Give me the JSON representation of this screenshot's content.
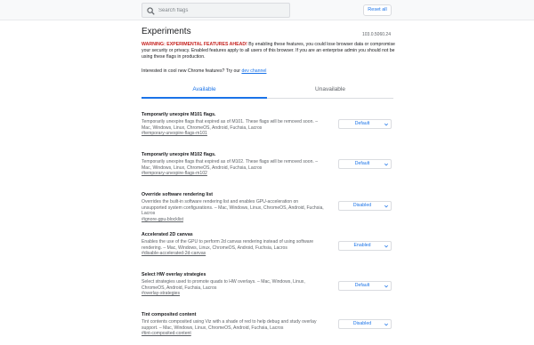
{
  "header": {
    "search_placeholder": "Search flags",
    "reset_label": "Reset all"
  },
  "page": {
    "title": "Experiments",
    "version": "103.0.5060.24",
    "warning_strong": "WARNING: EXPERIMENTAL FEATURES AHEAD!",
    "warning_text": " By enabling these features, you could lose browser data or compromise your security or privacy. Enabled features apply to all users of this browser. If you are an enterprise admin you should not be using these flags in production.",
    "interest_text": "Interested in cool new Chrome features? Try our ",
    "interest_link": "dev channel"
  },
  "tabs": {
    "available": "Available",
    "unavailable": "Unavailable"
  },
  "flags": [
    {
      "title": "Temporarily unexpire M101 flags.",
      "desc": "Temporarily unexpire flags that expired as of M101. These flags will be removed soon. – Mac, Windows, Linux, ChromeOS, Android, Fuchsia, Lacros",
      "link": "#temporary-unexpire-flags-m101",
      "value": "Default"
    },
    {
      "title": "Temporarily unexpire M102 flags.",
      "desc": "Temporarily unexpire flags that expired as of M102. These flags will be removed soon. – Mac, Windows, Linux, ChromeOS, Android, Fuchsia, Lacros",
      "link": "#temporary-unexpire-flags-m102",
      "value": "Default"
    },
    {
      "title": "Override software rendering list",
      "desc": "Overrides the built-in software rendering list and enables GPU-acceleration on unsupported system configurations. – Mac, Windows, Linux, ChromeOS, Android, Fuchsia, Lacros",
      "link": "#ignore-gpu-blocklist",
      "value": "Disabled"
    },
    {
      "title": "Accelerated 2D canvas",
      "desc": "Enables the use of the GPU to perform 2d canvas rendering instead of using software rendering. – Mac, Windows, Linux, ChromeOS, Android, Fuchsia, Lacros",
      "link": "#disable-accelerated-2d-canvas",
      "value": "Enabled"
    },
    {
      "title": "Select HW overlay strategies",
      "desc": "Select strategies used to promote quads to HW overlays. – Mac, Windows, Linux, ChromeOS, Android, Fuchsia, Lacros",
      "link": "#overlay-strategies",
      "value": "Default"
    },
    {
      "title": "Tint composited content",
      "desc": "Tint contents composited using Viz with a shade of red to help debug and study overlay support. – Mac, Windows, Linux, ChromeOS, Android, Fuchsia, Lacros",
      "link": "#tint-composited-content",
      "value": "Disabled"
    }
  ],
  "colors": {
    "accent": "#1a73e8",
    "warning": "#c5221f"
  }
}
